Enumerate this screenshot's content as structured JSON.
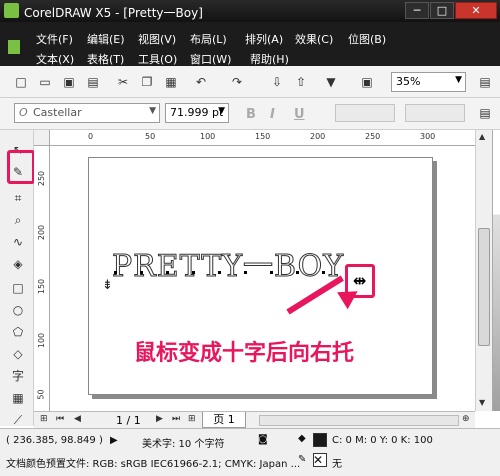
{
  "window": {
    "title": "CorelDRAW X5 - [Pretty一Boy]",
    "min_glyph": "─",
    "max_glyph": "□",
    "close_glyph": "✕"
  },
  "menu": {
    "row1": [
      "文件(F)",
      "编辑(E)",
      "视图(V)",
      "布局(L)",
      "排列(A)",
      "效果(C)",
      "位图(B)"
    ],
    "row2": [
      "文本(X)",
      "表格(T)",
      "工具(O)",
      "窗口(W)",
      "帮助(H)"
    ]
  },
  "toolbar": {
    "zoom_value": "35%"
  },
  "propbar": {
    "font_name": "Castellar",
    "font_size": "71.999 pt",
    "bold": "B",
    "italic": "I",
    "underline": "U"
  },
  "rulers": {
    "top": [
      "0",
      "50",
      "100",
      "150",
      "200",
      "250",
      "300"
    ],
    "left": [
      "250",
      "200",
      "150",
      "100",
      "50"
    ]
  },
  "canvas": {
    "art_text": "PRETTY一BOY",
    "annotation": "鼠标变成十字后向右托"
  },
  "pagenav": {
    "page_count": "1 / 1",
    "page_tab": "页 1"
  },
  "status": {
    "coords": "( 236.385, 98.849 )",
    "object_info": "美术字: 10 个字符",
    "fill_info": "C: 0 M: 0 Y: 0 K: 100",
    "color_profile": "文档颜色预置文件: RGB: sRGB IEC61966-2.1; CMYK: Japan ...",
    "outline_none": "无"
  },
  "colors": {
    "highlight": "#e8175d",
    "titlebar": "#1c1c1c"
  }
}
